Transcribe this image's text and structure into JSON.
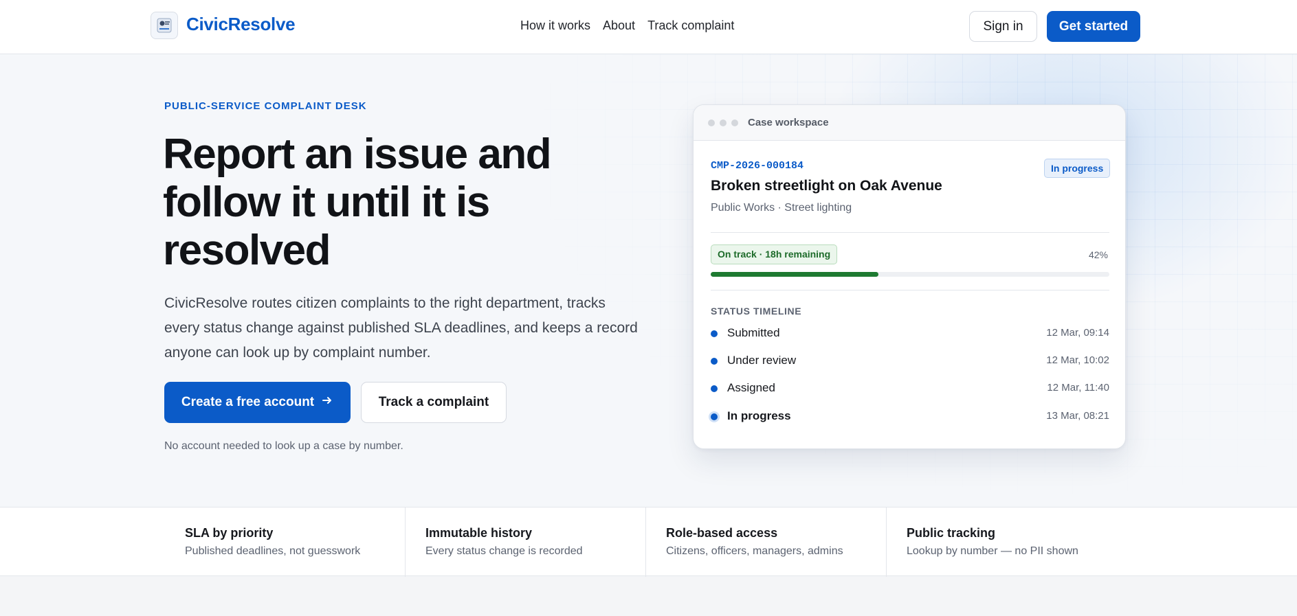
{
  "header": {
    "brand": "CivicResolve",
    "nav": [
      "How it works",
      "About",
      "Track complaint"
    ],
    "sign_in": "Sign in",
    "get_started": "Get started"
  },
  "hero": {
    "eyebrow": "PUBLIC-SERVICE COMPLAINT DESK",
    "title": "Report an issue and follow it until it is resolved",
    "description": "CivicResolve routes citizen complaints to the right department, tracks every status change against published SLA deadlines, and keeps a record anyone can look up by complaint number.",
    "primary_cta": "Create a free account",
    "secondary_cta": "Track a complaint",
    "note": "No account needed to look up a case by number."
  },
  "card": {
    "window_title": "Case workspace",
    "case_id": "CMP-2026-000184",
    "status": "In progress",
    "title": "Broken streetlight on Oak Avenue",
    "subtitle": "Public Works · Street lighting",
    "sla_label": "On track · 18h remaining",
    "progress_label": "42%",
    "progress_fraction": 0.42,
    "timeline_label": "STATUS TIMELINE",
    "timeline": [
      {
        "name": "Submitted",
        "time": "12 Mar, 09:14"
      },
      {
        "name": "Under review",
        "time": "12 Mar, 10:02"
      },
      {
        "name": "Assigned",
        "time": "12 Mar, 11:40"
      },
      {
        "name": "In progress",
        "time": "13 Mar, 08:21"
      }
    ]
  },
  "features": [
    {
      "title": "SLA by priority",
      "desc": "Published deadlines, not guesswork"
    },
    {
      "title": "Immutable history",
      "desc": "Every status change is recorded"
    },
    {
      "title": "Role-based access",
      "desc": "Citizens, officers, managers, admins"
    },
    {
      "title": "Public tracking",
      "desc": "Lookup by number — no PII shown"
    }
  ],
  "colors": {
    "accent": "#0b5bc8",
    "success": "#1e7a31"
  }
}
